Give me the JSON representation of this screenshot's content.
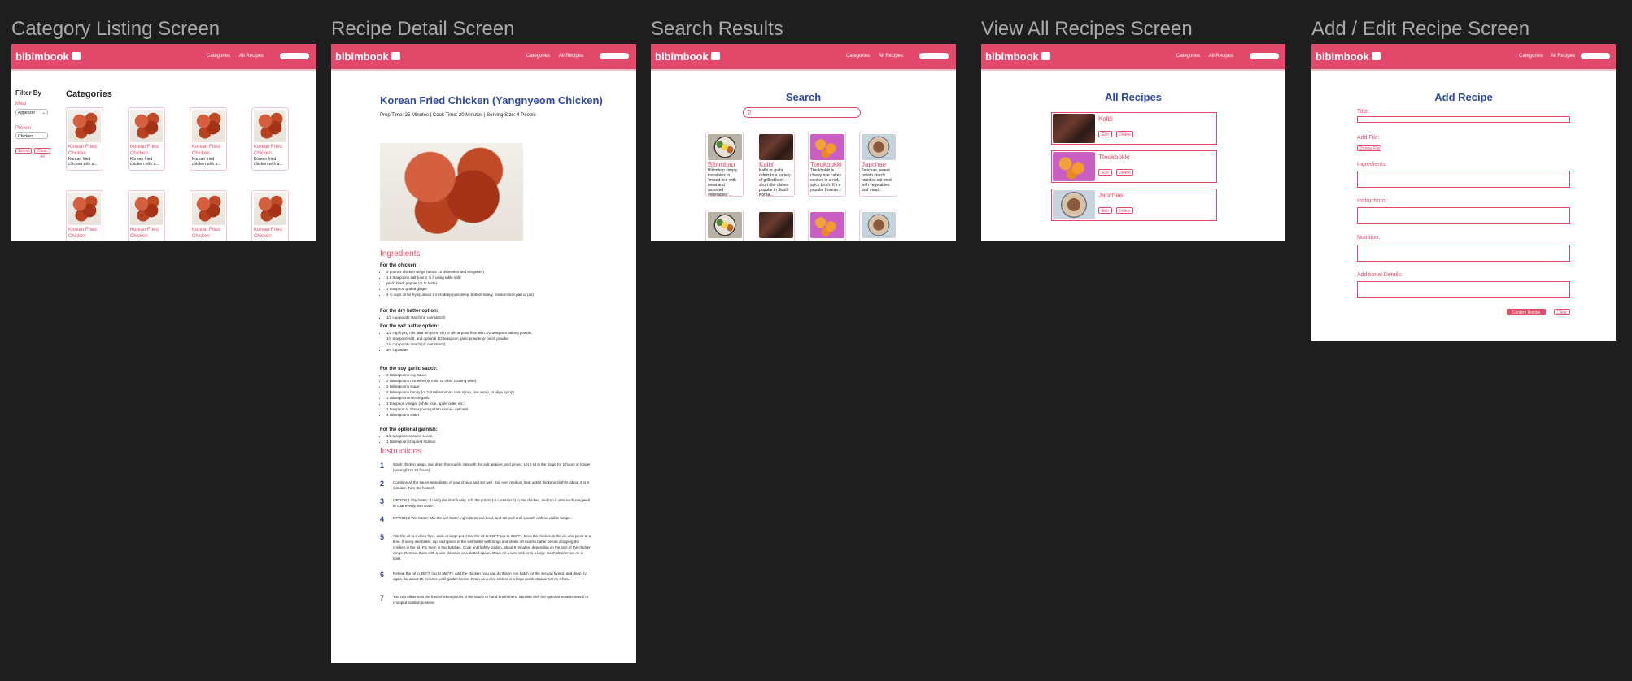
{
  "frames": {
    "category": "Category Listing Screen",
    "detail": "Recipe Detail Screen",
    "search": "Search Results",
    "all": "View All Recipes Screen",
    "add": "Add / Edit Recipe Screen"
  },
  "nav": {
    "logo": "bibimbook",
    "categories": "Categories",
    "all_recipes": "All Recipes"
  },
  "category_screen": {
    "filter_title": "Filter By",
    "meal_label": "Meal",
    "meal_value": "Appetizer",
    "protein_label": "Protein",
    "protein_value": "Chicken",
    "submit": "Submit",
    "clear": "Clear All",
    "heading": "Categories",
    "card_title": "Korean Fried Chicken",
    "card_desc": "Korean fried chicken with a..."
  },
  "detail_screen": {
    "title": "Korean Fried Chicken (Yangnyeom Chicken)",
    "meta": "Prep Time: 25 Minutes | Cook Time: 20 Minutes | Serving Size: 4 People",
    "ingredients_heading": "Ingredients",
    "groups": [
      {
        "title": "For the chicken:",
        "items": [
          "2 pounds chicken wings (about 16 drumettes and wingettes)",
          "1.5 teaspoons salt (use 1 ½ if using table salt)",
          "pinch black pepper (or to taste)",
          "1 teaspoon grated ginger",
          "4 ½ cups oil for frying about 2 inch deep (use deep, bottom heavy, medium size pan or pot)"
        ]
      },
      {
        "title": "For the dry batter option:",
        "items": [
          "1/2 cup potato starch (or cornstarch)"
        ]
      },
      {
        "title": "For the wet batter option:",
        "items": [
          "1/2 cup frying mix (aka tempura mix) or all-purpose flour with 1/2 teaspoon baking powder, 1/4 teaspoon salt, and optional 1/2 teaspoon garlic powder or onion powder",
          "1/4 cup potato starch (or cornstarch)",
          "3/4 cup water"
        ]
      },
      {
        "title": "For the soy garlic sauce:",
        "items": [
          "2 tablespoons soy sauce",
          "2 tablespoons rice wine (or mirin or other cooking wine)",
          "2 tablespoons sugar",
          "2 tablespoons honey (or 2-3 tablespoons corn syrup, rice syrup, or oligo syrup)",
          "1 tablespoon minced garlic",
          "1 teaspoon vinegar (white, rice, apple cider, etc.)",
          "1 teaspoon to 2 teaspoons potato sauce - optional",
          "4 tablespoons water"
        ]
      },
      {
        "title": "For the optional garnish:",
        "items": [
          "1/2 teaspoon sesame seeds",
          "1 tablespoon chopped scallion"
        ]
      }
    ],
    "instructions_heading": "Instructions",
    "steps": [
      {
        "n": "1",
        "text": "Wash chicken wings, and drain thoroughly. Mix with the salt, pepper, and ginger. Let it sit in the fridge for 2 hours or longer (overnight to 24 hours)."
      },
      {
        "n": "2",
        "text": "Combine all the sauce ingredients of your choice and stir well. Boil over medium heat until it thickens slightly, about 4 to 5 minutes. Turn the heat off."
      },
      {
        "n": "3",
        "text": "OPTION 1 Dry batter: If using the starch only, add the potato (or cornstarch) to the chicken, and rub it onto each wing well to coat evenly. Set aside."
      },
      {
        "n": "4",
        "text": "OPTION 2 Wet batter: Mix the wet batter ingredients in a bowl, and stir well until smooth with no visible lumps."
      },
      {
        "n": "5",
        "text": "Add the oil to a deep fryer, wok, or large pot. Heat the oil to 330°F (up to 350°F). Drop the chicken in the oil, one piece at a time. If using wet batter, dip each piece in the wet batter with tongs and shake off excess batter before dropping the chicken in the oil. Fry them in two batches. Cook until lightly golden, about 8 minutes, depending on the size of the chicken wings. Remove them with a wire skimmer or a slotted spoon. Drain on a wire rack or in a large mesh strainer set on a bowl."
      },
      {
        "n": "6",
        "text": "Reheat the oil to 350°F (up to 360°F). Add the chicken (you can do this in one batch for the second frying), and deep fry again, for about 10 minutes, until golden brown. Drain on a wire rack or in a large mesh strainer set on a bowl."
      },
      {
        "n": "7",
        "text": "You can either toss the fried chicken pieces in the sauce or hand brush them. Sprinkle with the optional sesame seeds or chopped scallion to serve."
      }
    ]
  },
  "search_screen": {
    "title": "Search",
    "results": [
      {
        "name": "Bibimbap",
        "desc": "Bibimbap simply translates to \"mixed rice with meat and assorted vegetables\"..."
      },
      {
        "name": "Kalbi",
        "desc": "Kalbi or galbi refers to a variety of grilled beef short ribs dishes popular in South Korea..."
      },
      {
        "name": "Tteokbokki",
        "desc": "Tteokbokki is chewy rice cakes cooked in a red, spicy broth. It's a popular Korean..."
      },
      {
        "name": "Japchae",
        "desc": "Japchae, sweet potato starch noodles stir fried with vegetables and meat..."
      }
    ]
  },
  "all_screen": {
    "title": "All Recipes",
    "edit": "Edit",
    "delete": "Delete",
    "recipes": [
      "Kalbi",
      "Tteokbokki",
      "Japchae"
    ]
  },
  "add_screen": {
    "title": "Add Recipe",
    "title_label": "Title:",
    "file_label": "Add File:",
    "choose_file": "Choose File",
    "ingredients_label": "Ingredients:",
    "instructions_label": "Instructions:",
    "nutrition_label": "Nutrition:",
    "details_label": "Additional Details:",
    "confirm": "Confirm Recipe",
    "clear": "Clear"
  }
}
